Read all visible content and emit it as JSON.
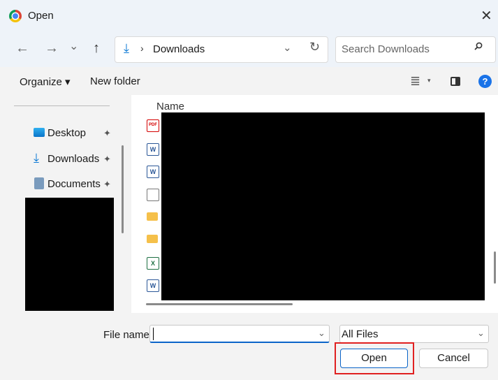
{
  "window": {
    "title": "Open"
  },
  "nav": {
    "back": "←",
    "forward": "→",
    "recent": "⌄",
    "up": "↑"
  },
  "address": {
    "separator": "›",
    "folder": "Downloads",
    "dropdown": "⌄",
    "refresh": "↻"
  },
  "search": {
    "placeholder": "Search Downloads"
  },
  "toolbar": {
    "organize": "Organize ▾",
    "new_folder": "New folder",
    "view": "≣",
    "view_caret": "▾",
    "help": "?"
  },
  "sidebar": {
    "items": [
      {
        "label": "Desktop",
        "icon": "desktop-icon"
      },
      {
        "label": "Downloads",
        "icon": "download-icon"
      },
      {
        "label": "Documents",
        "icon": "documents-icon"
      }
    ],
    "pin": "📌"
  },
  "filelist": {
    "column_name": "Name",
    "icons": [
      "pdf-icon",
      "word-icon",
      "word-icon",
      "blank-file-icon",
      "folder-icon",
      "folder-icon",
      "excel-icon",
      "word-icon"
    ],
    "pdf_badge": "PDF",
    "word_badge": "W",
    "excel_badge": "X"
  },
  "footer": {
    "file_name_label": "File name:",
    "file_name_value": "",
    "file_type": "All Files",
    "open": "Open",
    "cancel": "Cancel"
  },
  "colors": {
    "accent": "#0a64c8",
    "highlight": "#e02020"
  }
}
